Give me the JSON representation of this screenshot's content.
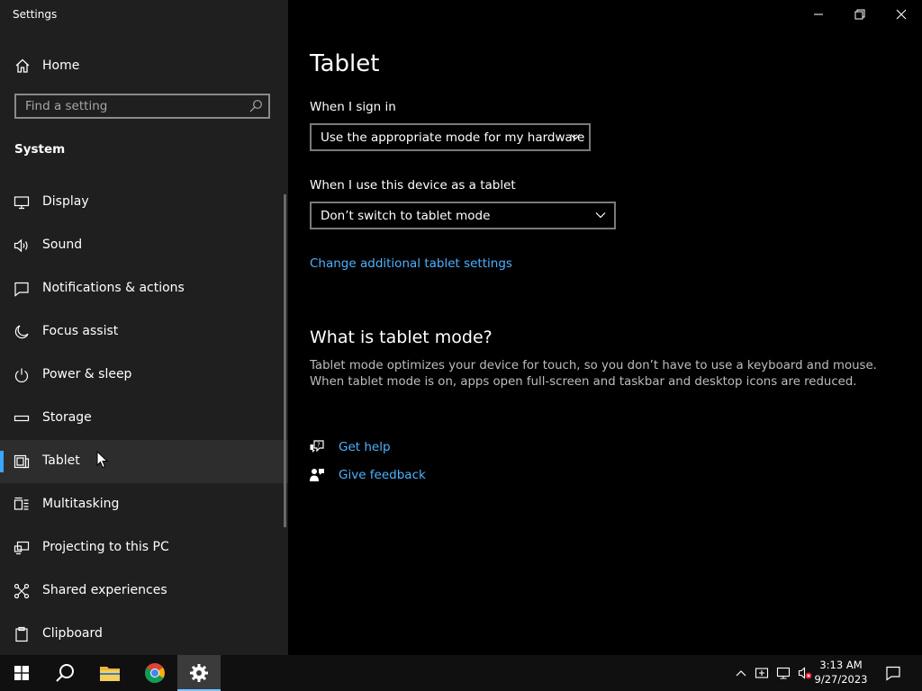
{
  "window": {
    "title": "Settings"
  },
  "sidebar": {
    "home_label": "Home",
    "search_placeholder": "Find a setting",
    "section_label": "System",
    "items": [
      {
        "label": "Display",
        "icon": "display-icon"
      },
      {
        "label": "Sound",
        "icon": "sound-icon"
      },
      {
        "label": "Notifications & actions",
        "icon": "notifications-icon"
      },
      {
        "label": "Focus assist",
        "icon": "moon-icon"
      },
      {
        "label": "Power & sleep",
        "icon": "power-icon"
      },
      {
        "label": "Storage",
        "icon": "storage-icon"
      },
      {
        "label": "Tablet",
        "icon": "tablet-icon",
        "selected": true
      },
      {
        "label": "Multitasking",
        "icon": "multitasking-icon"
      },
      {
        "label": "Projecting to this PC",
        "icon": "projecting-icon"
      },
      {
        "label": "Shared experiences",
        "icon": "shared-experiences-icon"
      },
      {
        "label": "Clipboard",
        "icon": "clipboard-icon"
      }
    ]
  },
  "main": {
    "title": "Tablet",
    "sign_in_label": "When I sign in",
    "sign_in_value": "Use the appropriate mode for my hardware",
    "tablet_use_label": "When I use this device as a tablet",
    "tablet_use_value": "Don’t switch to tablet mode",
    "additional_link": "Change additional tablet settings",
    "what_is_heading": "What is tablet mode?",
    "what_is_text": "Tablet mode optimizes your device for touch, so you don’t have to use a keyboard and mouse. When tablet mode is on, apps open full-screen and taskbar and desktop icons are reduced.",
    "get_help": "Get help",
    "give_feedback": "Give feedback"
  },
  "taskbar": {
    "time": "3:13 AM",
    "date": "9/27/2023"
  },
  "colors": {
    "accent": "#3aa6ff",
    "link": "#4db2ff",
    "sidebar_bg": "#1f1f1f",
    "content_bg": "#000000"
  }
}
